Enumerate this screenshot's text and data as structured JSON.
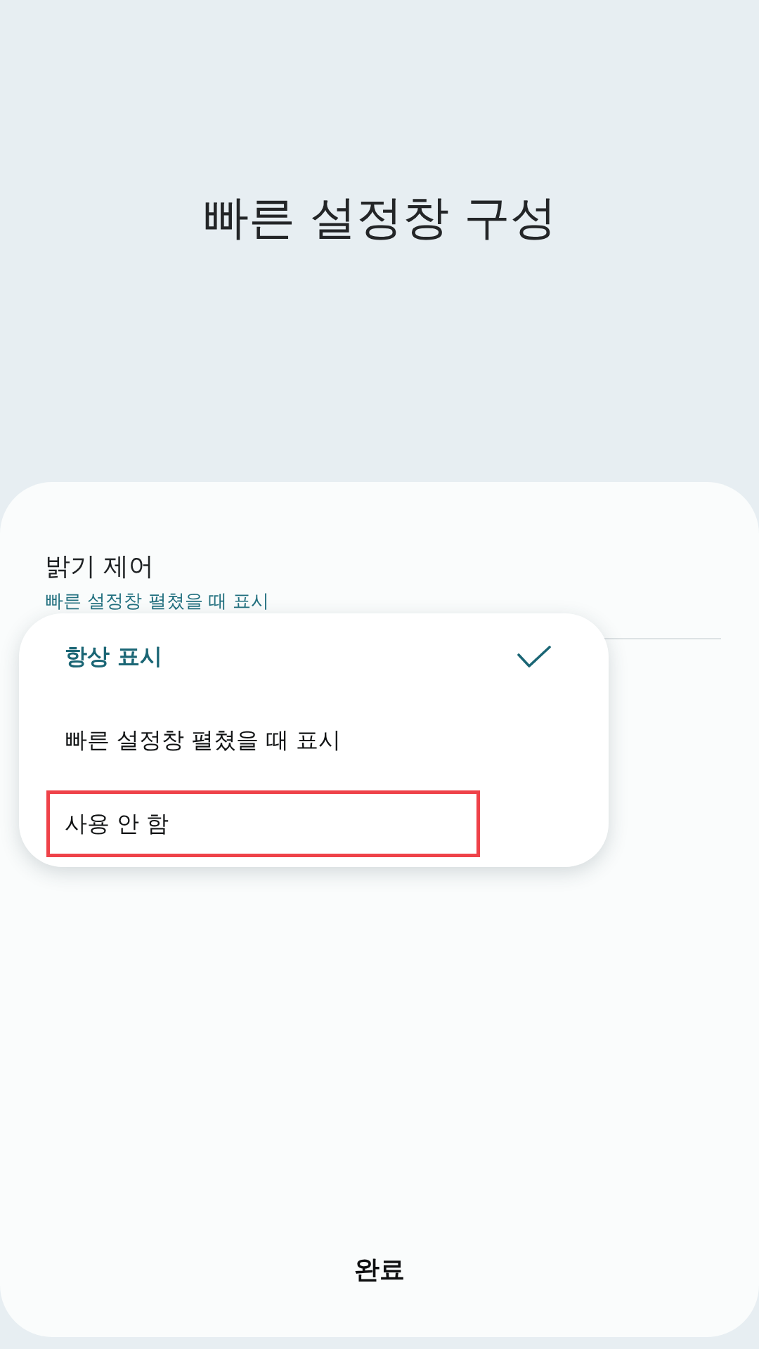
{
  "title": "빠른 설정창 구성",
  "setting": {
    "label": "밝기 제어",
    "value": "빠른 설정창 펼쳤을 때 표시"
  },
  "menu": {
    "options": [
      {
        "label": "항상 표시",
        "selected": true,
        "highlighted": false
      },
      {
        "label": "빠른 설정창 펼쳤을 때 표시",
        "selected": false,
        "highlighted": false
      },
      {
        "label": "사용 안 함",
        "selected": false,
        "highlighted": true
      }
    ]
  },
  "done_button": {
    "label": "완료"
  }
}
